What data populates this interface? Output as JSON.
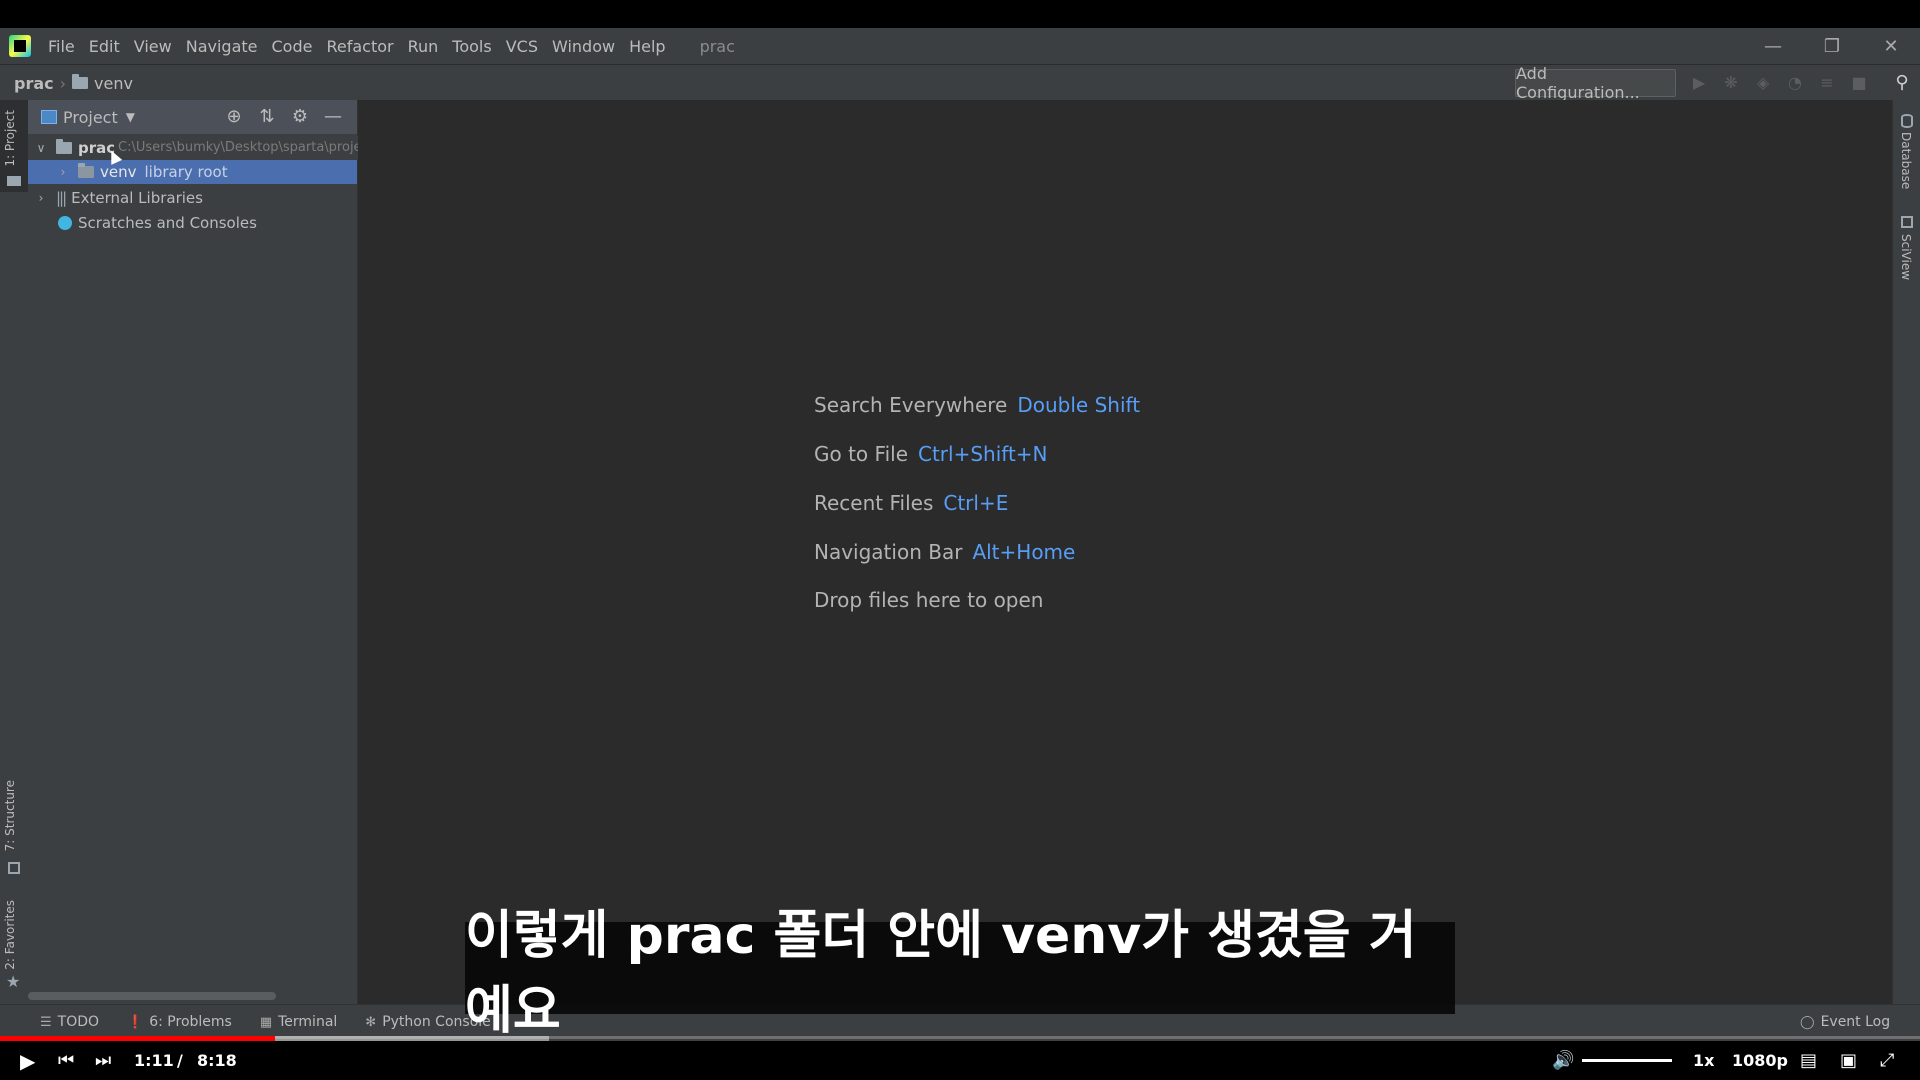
{
  "menubar": {
    "items": [
      "File",
      "Edit",
      "View",
      "Navigate",
      "Code",
      "Refactor",
      "Run",
      "Tools",
      "VCS",
      "Window",
      "Help"
    ],
    "project_title": "prac"
  },
  "navbar": {
    "root": "prac",
    "folder": "venv",
    "add_configuration": "Add Configuration..."
  },
  "left_strip": {
    "project_tab": "1: Project",
    "structure_tab": "7: Structure",
    "favorites_tab": "2: Favorites"
  },
  "project_panel": {
    "title": "Project",
    "tree": [
      {
        "label": "prac",
        "hint": "C:\\Users\\bumky\\Desktop\\sparta\\projects\\prac"
      },
      {
        "label": "venv",
        "hint": "library root"
      },
      {
        "label": "External Libraries"
      },
      {
        "label": "Scratches and Consoles"
      }
    ]
  },
  "editor": {
    "tips": [
      {
        "label": "Search Everywhere",
        "key": "Double Shift"
      },
      {
        "label": "Go to File",
        "key": "Ctrl+Shift+N"
      },
      {
        "label": "Recent Files",
        "key": "Ctrl+E"
      },
      {
        "label": "Navigation Bar",
        "key": "Alt+Home"
      },
      {
        "label": "Drop files here to open",
        "key": ""
      }
    ]
  },
  "right_strip": {
    "database_tab": "Database",
    "sciview_tab": "SciView"
  },
  "bottombar": {
    "tabs": [
      "TODO",
      "6: Problems",
      "Terminal",
      "Python Console"
    ],
    "event_log": "Event Log"
  },
  "video": {
    "subtitle": "이렇게 prac 폴더 안에 venv가 생겼을 거예요",
    "current_time": "1:11",
    "separator": "/",
    "duration": "8:18",
    "speed": "1x",
    "quality": "1080p",
    "progress_played_fraction": 0.143,
    "buffered_fraction": 0.286
  },
  "colors": {
    "accent_key": "#589df6",
    "selection": "#4b6eaf",
    "progress": "#ff0000"
  }
}
